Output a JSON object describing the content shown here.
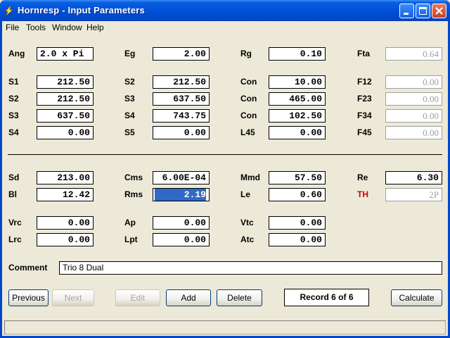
{
  "window": {
    "title": "Hornresp - Input Parameters"
  },
  "menu": [
    "File",
    "Tools",
    "Window",
    "Help"
  ],
  "col1": [
    {
      "label": "Ang",
      "value": "2.0 x Pi",
      "align": "left"
    },
    {
      "label": "S1",
      "value": "212.50"
    },
    {
      "label": "S2",
      "value": "212.50"
    },
    {
      "label": "S3",
      "value": "637.50"
    },
    {
      "label": "S4",
      "value": "0.00"
    }
  ],
  "col2": [
    {
      "label": "Eg",
      "value": "2.00"
    },
    {
      "label": "S2",
      "value": "212.50"
    },
    {
      "label": "S3",
      "value": "637.50"
    },
    {
      "label": "S4",
      "value": "743.75"
    },
    {
      "label": "S5",
      "value": "0.00"
    }
  ],
  "col3": [
    {
      "label": "Rg",
      "value": "0.10"
    },
    {
      "label": "Con",
      "value": "10.00"
    },
    {
      "label": "Con",
      "value": "465.00"
    },
    {
      "label": "Con",
      "value": "102.50"
    },
    {
      "label": "L45",
      "value": "0.00"
    }
  ],
  "col4": [
    {
      "label": "Fta",
      "value": "0.64"
    },
    {
      "label": "F12",
      "value": "0.00"
    },
    {
      "label": "F23",
      "value": "0.00"
    },
    {
      "label": "F34",
      "value": "0.00"
    },
    {
      "label": "F45",
      "value": "0.00"
    }
  ],
  "lower": {
    "sd": {
      "label": "Sd",
      "value": "213.00"
    },
    "cms": {
      "label": "Cms",
      "value": "6.00E-04"
    },
    "mmd": {
      "label": "Mmd",
      "value": "57.50"
    },
    "re": {
      "label": "Re",
      "value": "6.30"
    },
    "bl": {
      "label": "Bl",
      "value": "12.42"
    },
    "rms": {
      "label": "Rms",
      "value": "2.19"
    },
    "le": {
      "label": "Le",
      "value": "0.60"
    },
    "th": {
      "label": "TH",
      "value": "2P"
    },
    "vrc": {
      "label": "Vrc",
      "value": "0.00"
    },
    "ap": {
      "label": "Ap",
      "value": "0.00"
    },
    "vtc": {
      "label": "Vtc",
      "value": "0.00"
    },
    "lrc": {
      "label": "Lrc",
      "value": "0.00"
    },
    "lpt": {
      "label": "Lpt",
      "value": "0.00"
    },
    "atc": {
      "label": "Atc",
      "value": "0.00"
    }
  },
  "comment": {
    "label": "Comment",
    "value": "Trio 8 Dual"
  },
  "buttons": {
    "previous": "Previous",
    "next": "Next",
    "edit": "Edit",
    "add": "Add",
    "delete": "Delete",
    "record": "Record 6 of 6",
    "calculate": "Calculate"
  },
  "colors": {
    "titlebar": "#0050D8",
    "selection": "#316AC5",
    "th_label": "#D00000",
    "disabled_text": "#A0A0A0"
  }
}
